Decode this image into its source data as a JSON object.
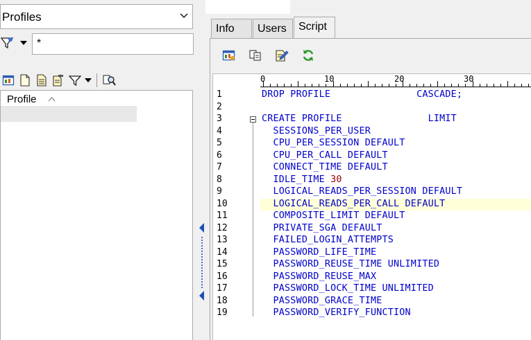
{
  "left": {
    "dropdown_value": "Profiles",
    "filter_value": "*",
    "list_header": "Profile"
  },
  "tabs": [
    {
      "label": "Info"
    },
    {
      "label": "Users"
    },
    {
      "label": "Script"
    }
  ],
  "ruler": {
    "marks": [
      "0",
      "10",
      "20",
      "30"
    ]
  },
  "script": {
    "lines": [
      {
        "num": "1",
        "text": "DROP PROFILE               CASCADE;"
      },
      {
        "num": "2",
        "text": ""
      },
      {
        "num": "3",
        "text": "CREATE PROFILE               LIMIT"
      },
      {
        "num": "4",
        "text": "  SESSIONS_PER_USER"
      },
      {
        "num": "5",
        "text": "  CPU_PER_SESSION DEFAULT"
      },
      {
        "num": "6",
        "text": "  CPU_PER_CALL DEFAULT"
      },
      {
        "num": "7",
        "text": "  CONNECT_TIME DEFAULT"
      },
      {
        "num": "8",
        "text": "  IDLE_TIME ",
        "number": "30"
      },
      {
        "num": "9",
        "text": "  LOGICAL_READS_PER_SESSION DEFAULT"
      },
      {
        "num": "10",
        "text": "  LOGICAL_READS_PER_CALL DEFAULT"
      },
      {
        "num": "11",
        "text": "  COMPOSITE_LIMIT DEFAULT"
      },
      {
        "num": "12",
        "text": "  PRIVATE_SGA DEFAULT"
      },
      {
        "num": "13",
        "text": "  FAILED_LOGIN_ATTEMPTS"
      },
      {
        "num": "14",
        "text": "  PASSWORD_LIFE_TIME"
      },
      {
        "num": "15",
        "text": "  PASSWORD_REUSE_TIME UNLIMITED"
      },
      {
        "num": "16",
        "text": "  PASSWORD_REUSE_MAX"
      },
      {
        "num": "17",
        "text": "  PASSWORD_LOCK_TIME UNLIMITED"
      },
      {
        "num": "18",
        "text": "  PASSWORD_GRACE_TIME"
      },
      {
        "num": "19",
        "text": "  PASSWORD_VERIFY_FUNCTION"
      }
    ],
    "highlighted_line": 10
  }
}
